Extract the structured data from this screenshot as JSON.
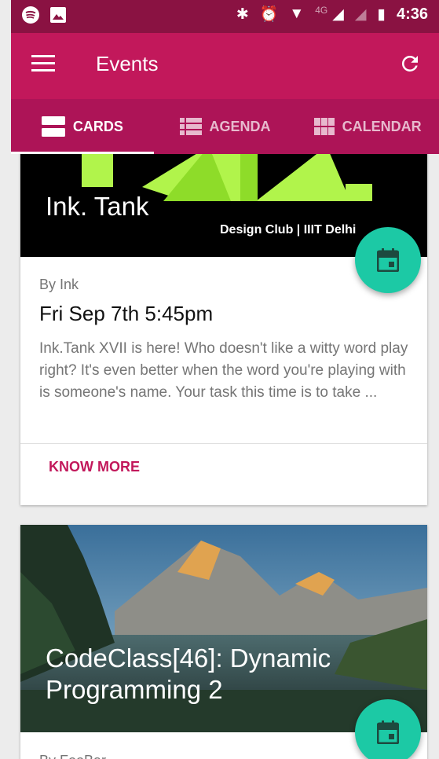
{
  "status_bar": {
    "time": "4:36",
    "network": "4G",
    "left_icons": [
      "spotify-icon",
      "image-icon"
    ],
    "right_icons": [
      "bluetooth-icon",
      "alarm-icon",
      "wifi-icon",
      "signal-icon",
      "signal-icon-2",
      "battery-icon"
    ]
  },
  "app_bar": {
    "title": "Events",
    "color": "#c2185b"
  },
  "tabs": [
    {
      "label": "CARDS",
      "icon": "cards-icon",
      "active": true
    },
    {
      "label": "AGENDA",
      "icon": "agenda-icon",
      "active": false
    },
    {
      "label": "CALENDAR",
      "icon": "calendar-grid-icon",
      "active": false
    }
  ],
  "cards": [
    {
      "title": "Ink. Tank",
      "image_caption": "Design Club | IIIT Delhi",
      "author": "By Ink",
      "date": "Fri Sep 7th 5:45pm",
      "description": "Ink.Tank XVII is here! Who doesn't like a witty word play right? It's even better when the word you're playing with is someone's name. Your task this time is to take ...",
      "action": "KNOW MORE"
    },
    {
      "title": "CodeClass[46]: Dynamic Programming 2",
      "author": "By FooBar"
    }
  ],
  "colors": {
    "primary": "#c2185b",
    "primary_dark": "#8a1242",
    "tab_bar": "#ad1457",
    "fab": "#1cc9a5"
  }
}
